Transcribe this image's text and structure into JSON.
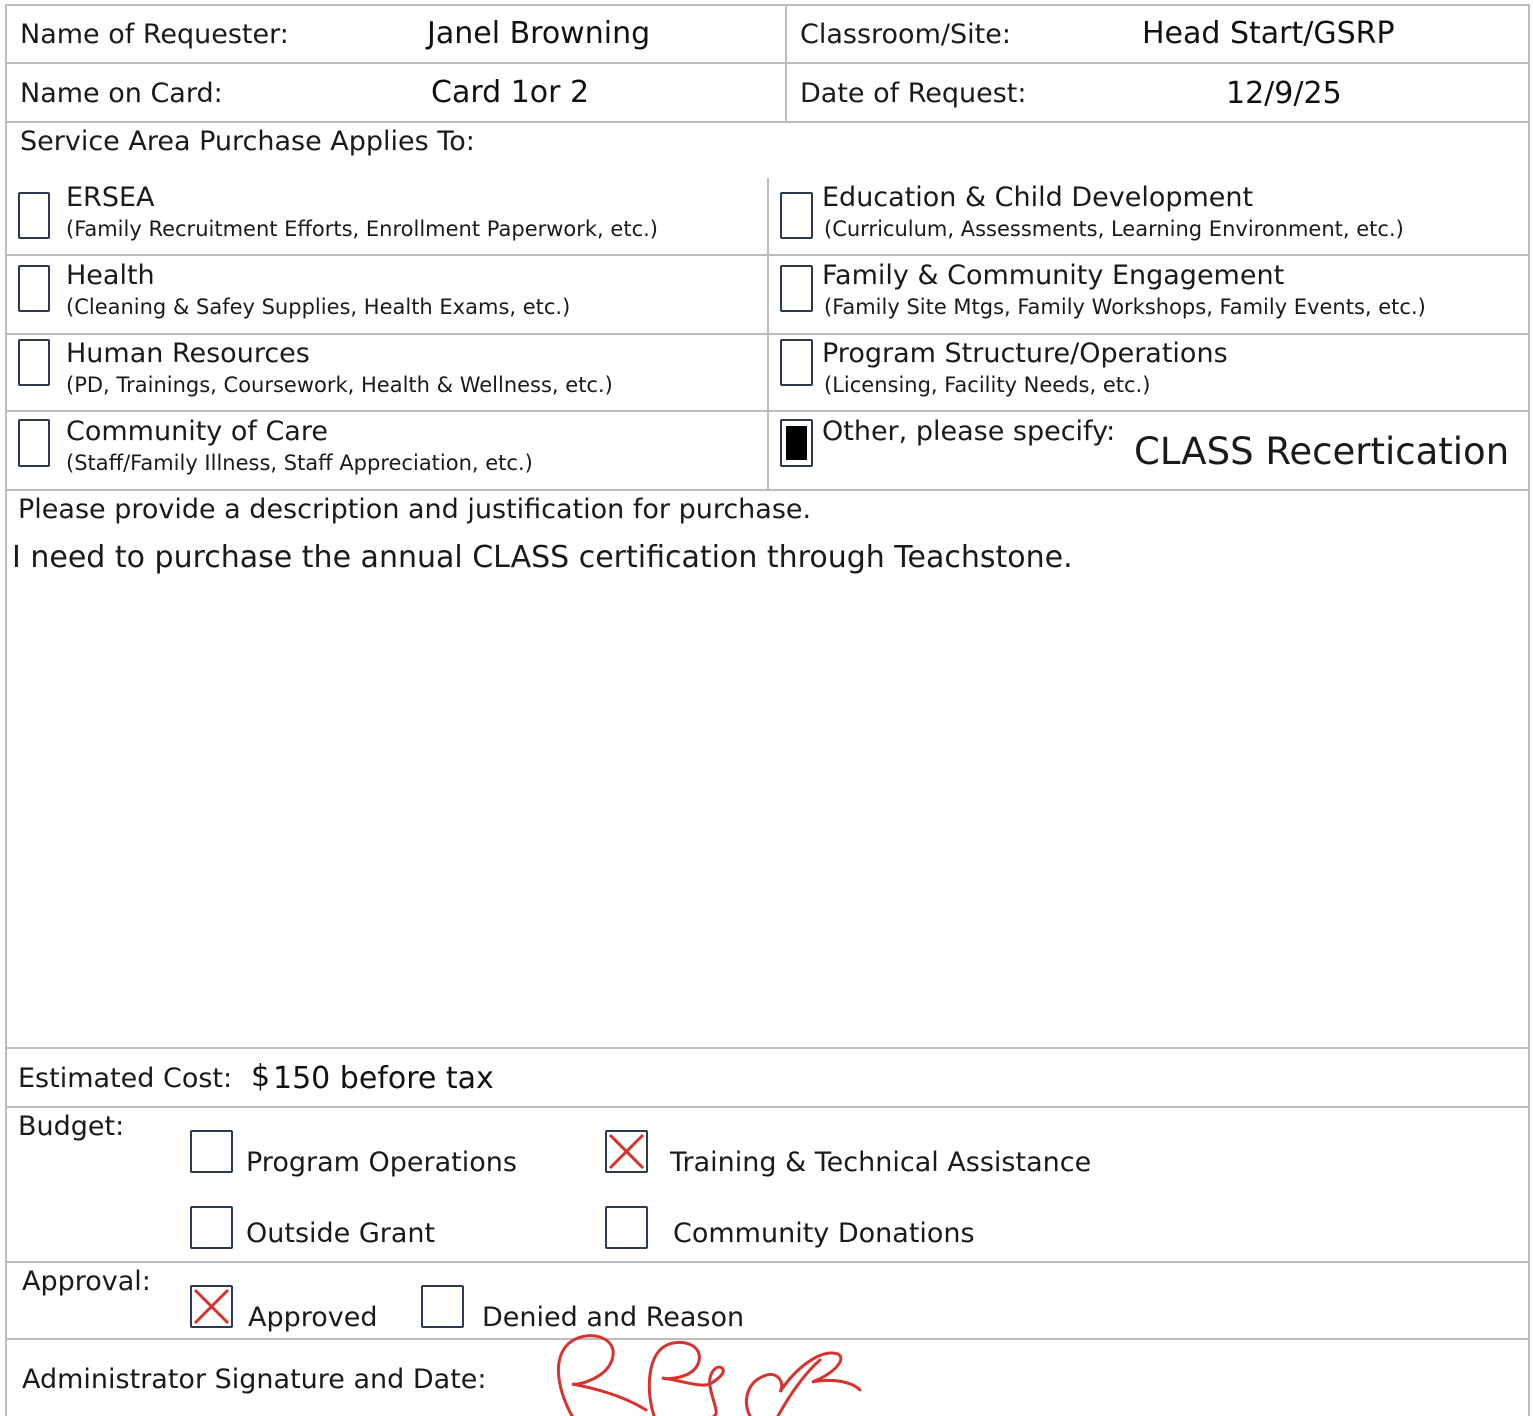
{
  "header": {
    "requester_label": "Name of Requester:",
    "requester_value": "Janel Browning",
    "site_label": "Classroom/Site:",
    "site_value": "Head Start/GSRP",
    "card_label": "Name on Card:",
    "card_value": "Card 1or 2",
    "date_label": "Date of Request:",
    "date_value": "12/9/25"
  },
  "service_area": {
    "heading": "Service Area Purchase Applies To:",
    "items": [
      {
        "title": "ERSEA",
        "subtitle": "(Family Recruitment Efforts, Enrollment Paperwork, etc.)",
        "checked": false
      },
      {
        "title": "Education & Child Development",
        "subtitle": "(Curriculum, Assessments, Learning Environment, etc.)",
        "checked": false
      },
      {
        "title": "Health",
        "subtitle": "(Cleaning & Safey Supplies, Health Exams, etc.)",
        "checked": false
      },
      {
        "title": "Family & Community Engagement",
        "subtitle": "(Family Site Mtgs, Family Workshops, Family Events, etc.)",
        "checked": false
      },
      {
        "title": "Human Resources",
        "subtitle": "(PD, Trainings, Coursework, Health & Wellness, etc.)",
        "checked": false
      },
      {
        "title": "Program Structure/Operations",
        "subtitle": "(Licensing, Facility Needs, etc.)",
        "checked": false
      },
      {
        "title": "Community of Care",
        "subtitle": "(Staff/Family Illness, Staff Appreciation, etc.)",
        "checked": false
      },
      {
        "title": "Other, please specify:",
        "subtitle": "",
        "checked": true,
        "specify_value": "CLASS Recertication"
      }
    ]
  },
  "description": {
    "prompt": "Please provide a description and justification for purchase.",
    "text": "I need to purchase the annual CLASS certification through Teachstone."
  },
  "cost": {
    "label": "Estimated Cost:",
    "currency": "$",
    "value": "150 before tax"
  },
  "budget": {
    "label": "Budget:",
    "options": [
      {
        "label": "Program Operations",
        "checked": false
      },
      {
        "label": "Training & Technical Assistance",
        "checked": true
      },
      {
        "label": "Outside Grant",
        "checked": false
      },
      {
        "label": "Community Donations",
        "checked": false
      }
    ]
  },
  "approval": {
    "label": "Approval:",
    "options": [
      {
        "label": "Approved",
        "checked": true
      },
      {
        "label": "Denied and Reason",
        "checked": false
      }
    ]
  },
  "signature": {
    "label": "Administrator Signature and Date:"
  },
  "colors": {
    "grid_line": "#bdbdbd",
    "checkbox_border": "#2b3a4e",
    "mark_red": "#d8322f"
  }
}
